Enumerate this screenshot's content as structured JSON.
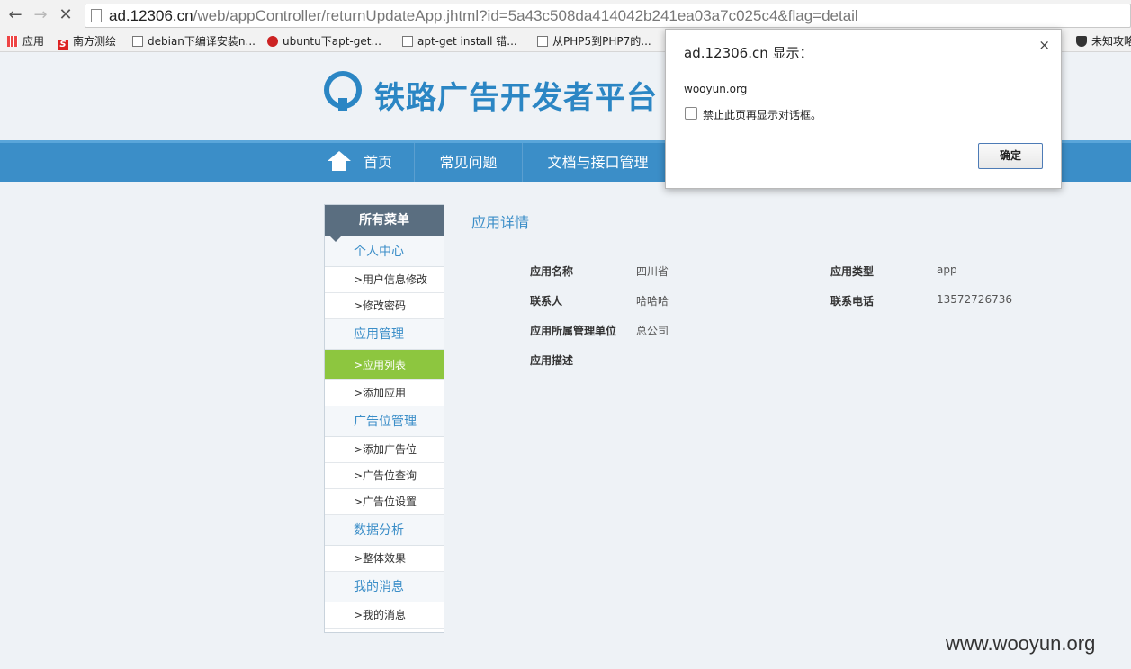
{
  "browser": {
    "url_host": "ad.12306.cn",
    "url_path": "/web/appController/returnUpdateApp.jhtml?id=5a43c508da414042b241ea03a7c025c4&flag=detail",
    "bookmarks": [
      "应用",
      "南方测绘",
      "debian下编译安装n...",
      "ubuntu下apt-get...",
      "apt-get install 错...",
      "从PHP5到PHP7的...",
      "未知攻略"
    ]
  },
  "header": {
    "logo_text": "铁路广告开发者平台"
  },
  "nav": {
    "items": [
      "首页",
      "常见问题",
      "文档与接口管理"
    ]
  },
  "sidebar": {
    "title": "所有菜单",
    "group1": "个人中心",
    "group1_links": [
      ">用户信息修改",
      ">修改密码"
    ],
    "group2": "应用管理",
    "group2_links": [
      ">应用列表",
      ">添加应用"
    ],
    "group3": "广告位管理",
    "group3_links": [
      ">添加广告位",
      ">广告位查询",
      ">广告位设置"
    ],
    "group4": "数据分析",
    "group4_links": [
      ">整体效果"
    ],
    "group5": "我的消息",
    "group5_links": [
      ">我的消息"
    ]
  },
  "content": {
    "title": "应用详情",
    "app_name_label": "应用名称",
    "app_name_value": "四川省",
    "app_type_label": "应用类型",
    "app_type_value": "app",
    "contact_label": "联系人",
    "contact_value": "哈哈哈",
    "phone_label": "联系电话",
    "phone_value": "13572726736",
    "unit_label": "应用所属管理单位",
    "unit_value": "总公司",
    "desc_label": "应用描述"
  },
  "dialog": {
    "title": "ad.12306.cn 显示：",
    "close": "×",
    "message": "wooyun.org",
    "checkbox_label": "禁止此页再显示对话框。",
    "ok_label": "确定"
  },
  "watermark": "www.wooyun.org",
  "colors": {
    "nav_blue": "#3b8ec8",
    "active_green": "#8dc63f",
    "sidebar_head": "#5a6e80"
  }
}
